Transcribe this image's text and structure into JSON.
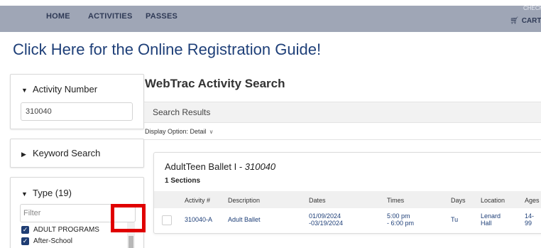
{
  "nav": {
    "home": "HOME",
    "activities": "ACTIVITIES",
    "passes": "PASSES",
    "checkout": "CHECKOUT",
    "cart": "CART"
  },
  "banner": {
    "registration_link": "Click Here for the Online Registration Guide!"
  },
  "sidebar": {
    "activity_number": {
      "title": "Activity Number",
      "value": "310040"
    },
    "keyword_search": {
      "title": "Keyword Search"
    },
    "type": {
      "title": "Type (19)",
      "filter_placeholder": "Filter",
      "items": [
        {
          "label": "ADULT PROGRAMS",
          "checked": true
        },
        {
          "label": "After-School",
          "checked": true
        }
      ]
    }
  },
  "main": {
    "title": "WebTrac Activity Search",
    "results_label": "Search Results",
    "display_option_label": "Display Option:",
    "display_option_value": "Detail",
    "activity": {
      "name": "AdultTeen Ballet I",
      "separator": " - ",
      "code": "310040",
      "sections_label": "1 Sections",
      "columns": [
        "Activity #",
        "Description",
        "Dates",
        "Times",
        "Days",
        "Location",
        "Ages"
      ],
      "rows": [
        {
          "activity_num": "310040-A",
          "description": "Adult Ballet",
          "dates_start": "01/09/2024",
          "dates_end": "-03/19/2024",
          "times_start": "5:00 pm",
          "times_end": "- 6:00 pm",
          "days": "Tu",
          "location_1": "Lenard",
          "location_2": "Hall",
          "ages_1": "14-",
          "ages_2": "99"
        }
      ]
    }
  },
  "colors": {
    "nav_bg": "#9fa6b6",
    "brand_blue": "#1e3f78",
    "checkbox_blue": "#1f3d73",
    "highlight_red": "#e00000"
  }
}
